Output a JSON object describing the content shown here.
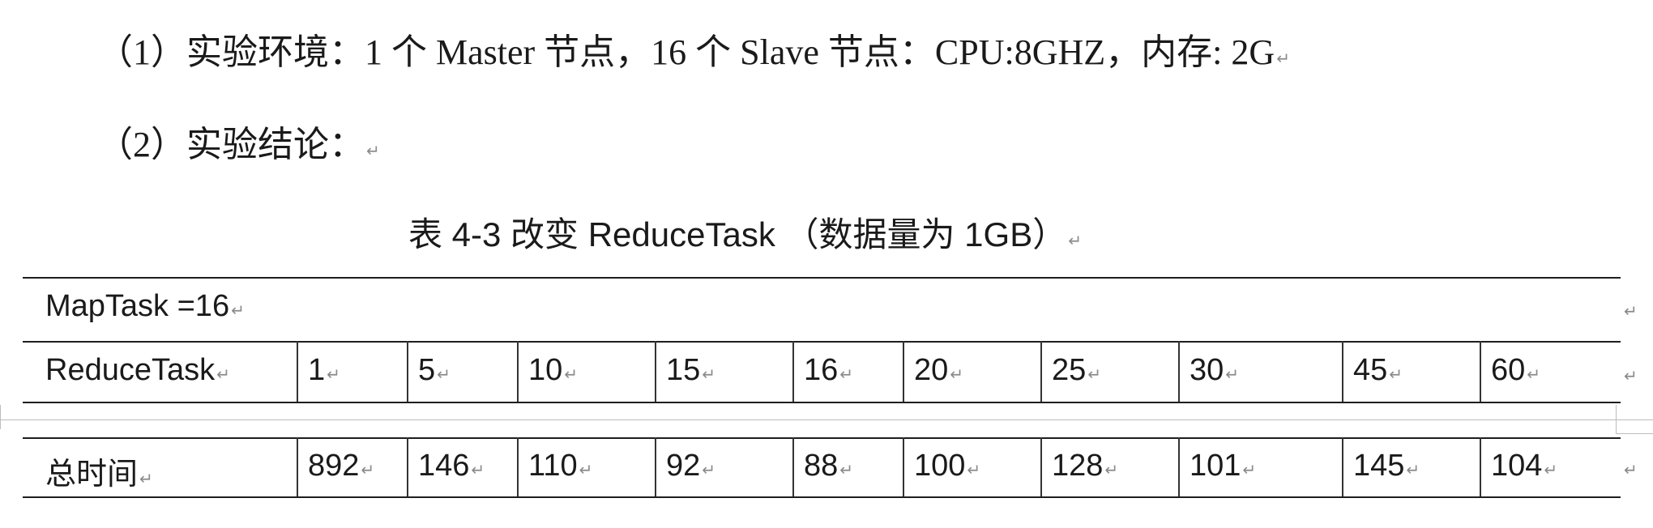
{
  "paragraphs": {
    "env": "（1）实验环境：1 个 Master 节点，16 个 Slave 节点：CPU:8GHZ，内存: 2G",
    "conclusion": "（2）实验结论："
  },
  "table": {
    "caption": "表 4-3  改变 ReduceTask （数据量为 1GB）",
    "header_row": "MapTask =16",
    "reduce_label": "ReduceTask",
    "reduce_values": [
      "1",
      "5",
      "10",
      "15",
      "16",
      "20",
      "25",
      "30",
      "45",
      "60"
    ],
    "time_label": "总时间",
    "time_values": [
      "892",
      "146",
      "110",
      "92",
      "88",
      "100",
      "128",
      "101",
      "145",
      "104"
    ]
  }
}
